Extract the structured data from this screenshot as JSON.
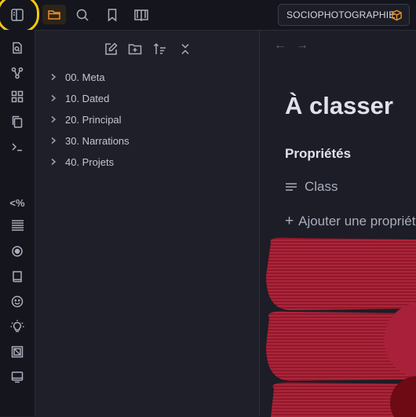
{
  "topbar": {
    "vault_name": "SOCIOPHOTOGRAPHIE",
    "icons": [
      "sidebar-toggle-icon",
      "folder-icon",
      "search-icon",
      "bookmark-icon",
      "book-open-icon"
    ],
    "accent_color": "#e8912d",
    "highlight_color": "#f6c90e"
  },
  "ribbon": {
    "icons": [
      "file-search-icon",
      "graph-icon",
      "layout-grid-icon",
      "copy-icon",
      "terminal-icon",
      "template-icon",
      "list-icon",
      "target-icon",
      "book-icon",
      "smile-icon",
      "bulb-icon",
      "layers-icon",
      "monitor-icon"
    ],
    "template_label": "<%"
  },
  "explorer": {
    "toolbar": [
      "new-note-icon",
      "new-folder-icon",
      "sort-icon",
      "collapse-icon"
    ],
    "folders": [
      {
        "label": "00. Meta"
      },
      {
        "label": "10. Dated"
      },
      {
        "label": "20. Principal"
      },
      {
        "label": "30. Narrations"
      },
      {
        "label": "40. Projets"
      }
    ]
  },
  "note": {
    "back": "←",
    "forward": "→",
    "title": "À classer",
    "properties_heading": "Propriétés",
    "property_name": "Class",
    "add_property": "Ajouter une propriété",
    "add_plus": "+"
  }
}
